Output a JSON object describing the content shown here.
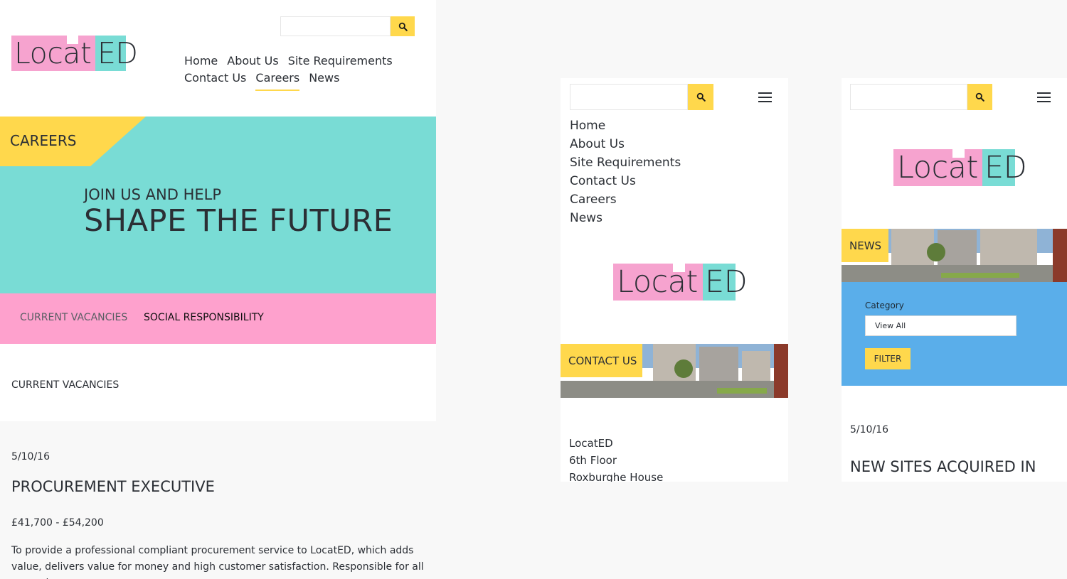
{
  "desktop": {
    "logo": {
      "part_a": "Locat",
      "part_b": "ED"
    },
    "search": {
      "placeholder": ""
    },
    "nav": [
      "Home",
      "About Us",
      "Site Requirements",
      "Contact Us",
      "Careers",
      "News"
    ],
    "hero": {
      "tag": "CAREERS",
      "sub": "JOIN US AND HELP",
      "title": "SHAPE THE FUTURE"
    },
    "tabs": [
      "CURRENT VACANCIES",
      "SOCIAL RESPONSIBILITY"
    ],
    "section_title": "CURRENT VACANCIES",
    "job": {
      "date": "5/10/16",
      "title": "PROCUREMENT EXECUTIVE",
      "salary": "£41,700 - £54,200",
      "description": "To provide a professional compliant procurement service to LocatED, which adds value, delivers value for money and high customer satisfaction. Responsible for all managing"
    }
  },
  "mobile_contact": {
    "nav": [
      "Home",
      "About Us",
      "Site Requirements",
      "Contact Us",
      "Careers",
      "News"
    ],
    "logo": {
      "part_a": "Locat",
      "part_b": "ED"
    },
    "banner_label": "CONTACT US",
    "address": [
      "LocatED",
      "6th Floor",
      "Roxburghe House"
    ]
  },
  "mobile_news": {
    "logo": {
      "part_a": "Locat",
      "part_b": "ED"
    },
    "banner_label": "NEWS",
    "filter": {
      "label": "Category",
      "selected": "View All",
      "button": "FILTER"
    },
    "date": "5/10/16",
    "title": "NEW SITES ACQUIRED IN"
  },
  "colors": {
    "yellow": "#ffd84c",
    "teal": "#79dcd5",
    "pink": "#fea1cd",
    "blue": "#5aaeea"
  }
}
